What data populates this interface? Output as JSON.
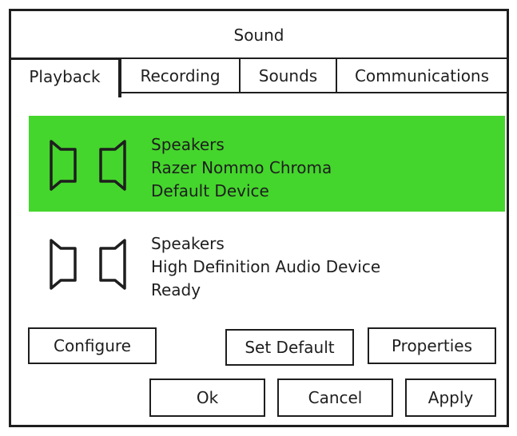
{
  "window": {
    "title": "Sound"
  },
  "tabs": [
    {
      "label": "Playback",
      "active": true
    },
    {
      "label": "Recording",
      "active": false
    },
    {
      "label": "Sounds",
      "active": false
    },
    {
      "label": "Communications",
      "active": false
    }
  ],
  "devices": [
    {
      "icon": "speaker-icon",
      "type": "Speakers",
      "name": "Razer Nommo Chroma",
      "status": "Default Device",
      "selected": true,
      "highlight_color": "#44d62c"
    },
    {
      "icon": "speaker-icon",
      "type": "Speakers",
      "name": "High Definition Audio Device",
      "status": "Ready",
      "selected": false
    }
  ],
  "buttons": {
    "configure": "Configure",
    "set_default": "Set Default",
    "properties": "Properties",
    "ok": "Ok",
    "cancel": "Cancel",
    "apply": "Apply"
  },
  "colors": {
    "accent": "#44d62c",
    "border": "#1e1e1e",
    "background": "#ffffff"
  }
}
